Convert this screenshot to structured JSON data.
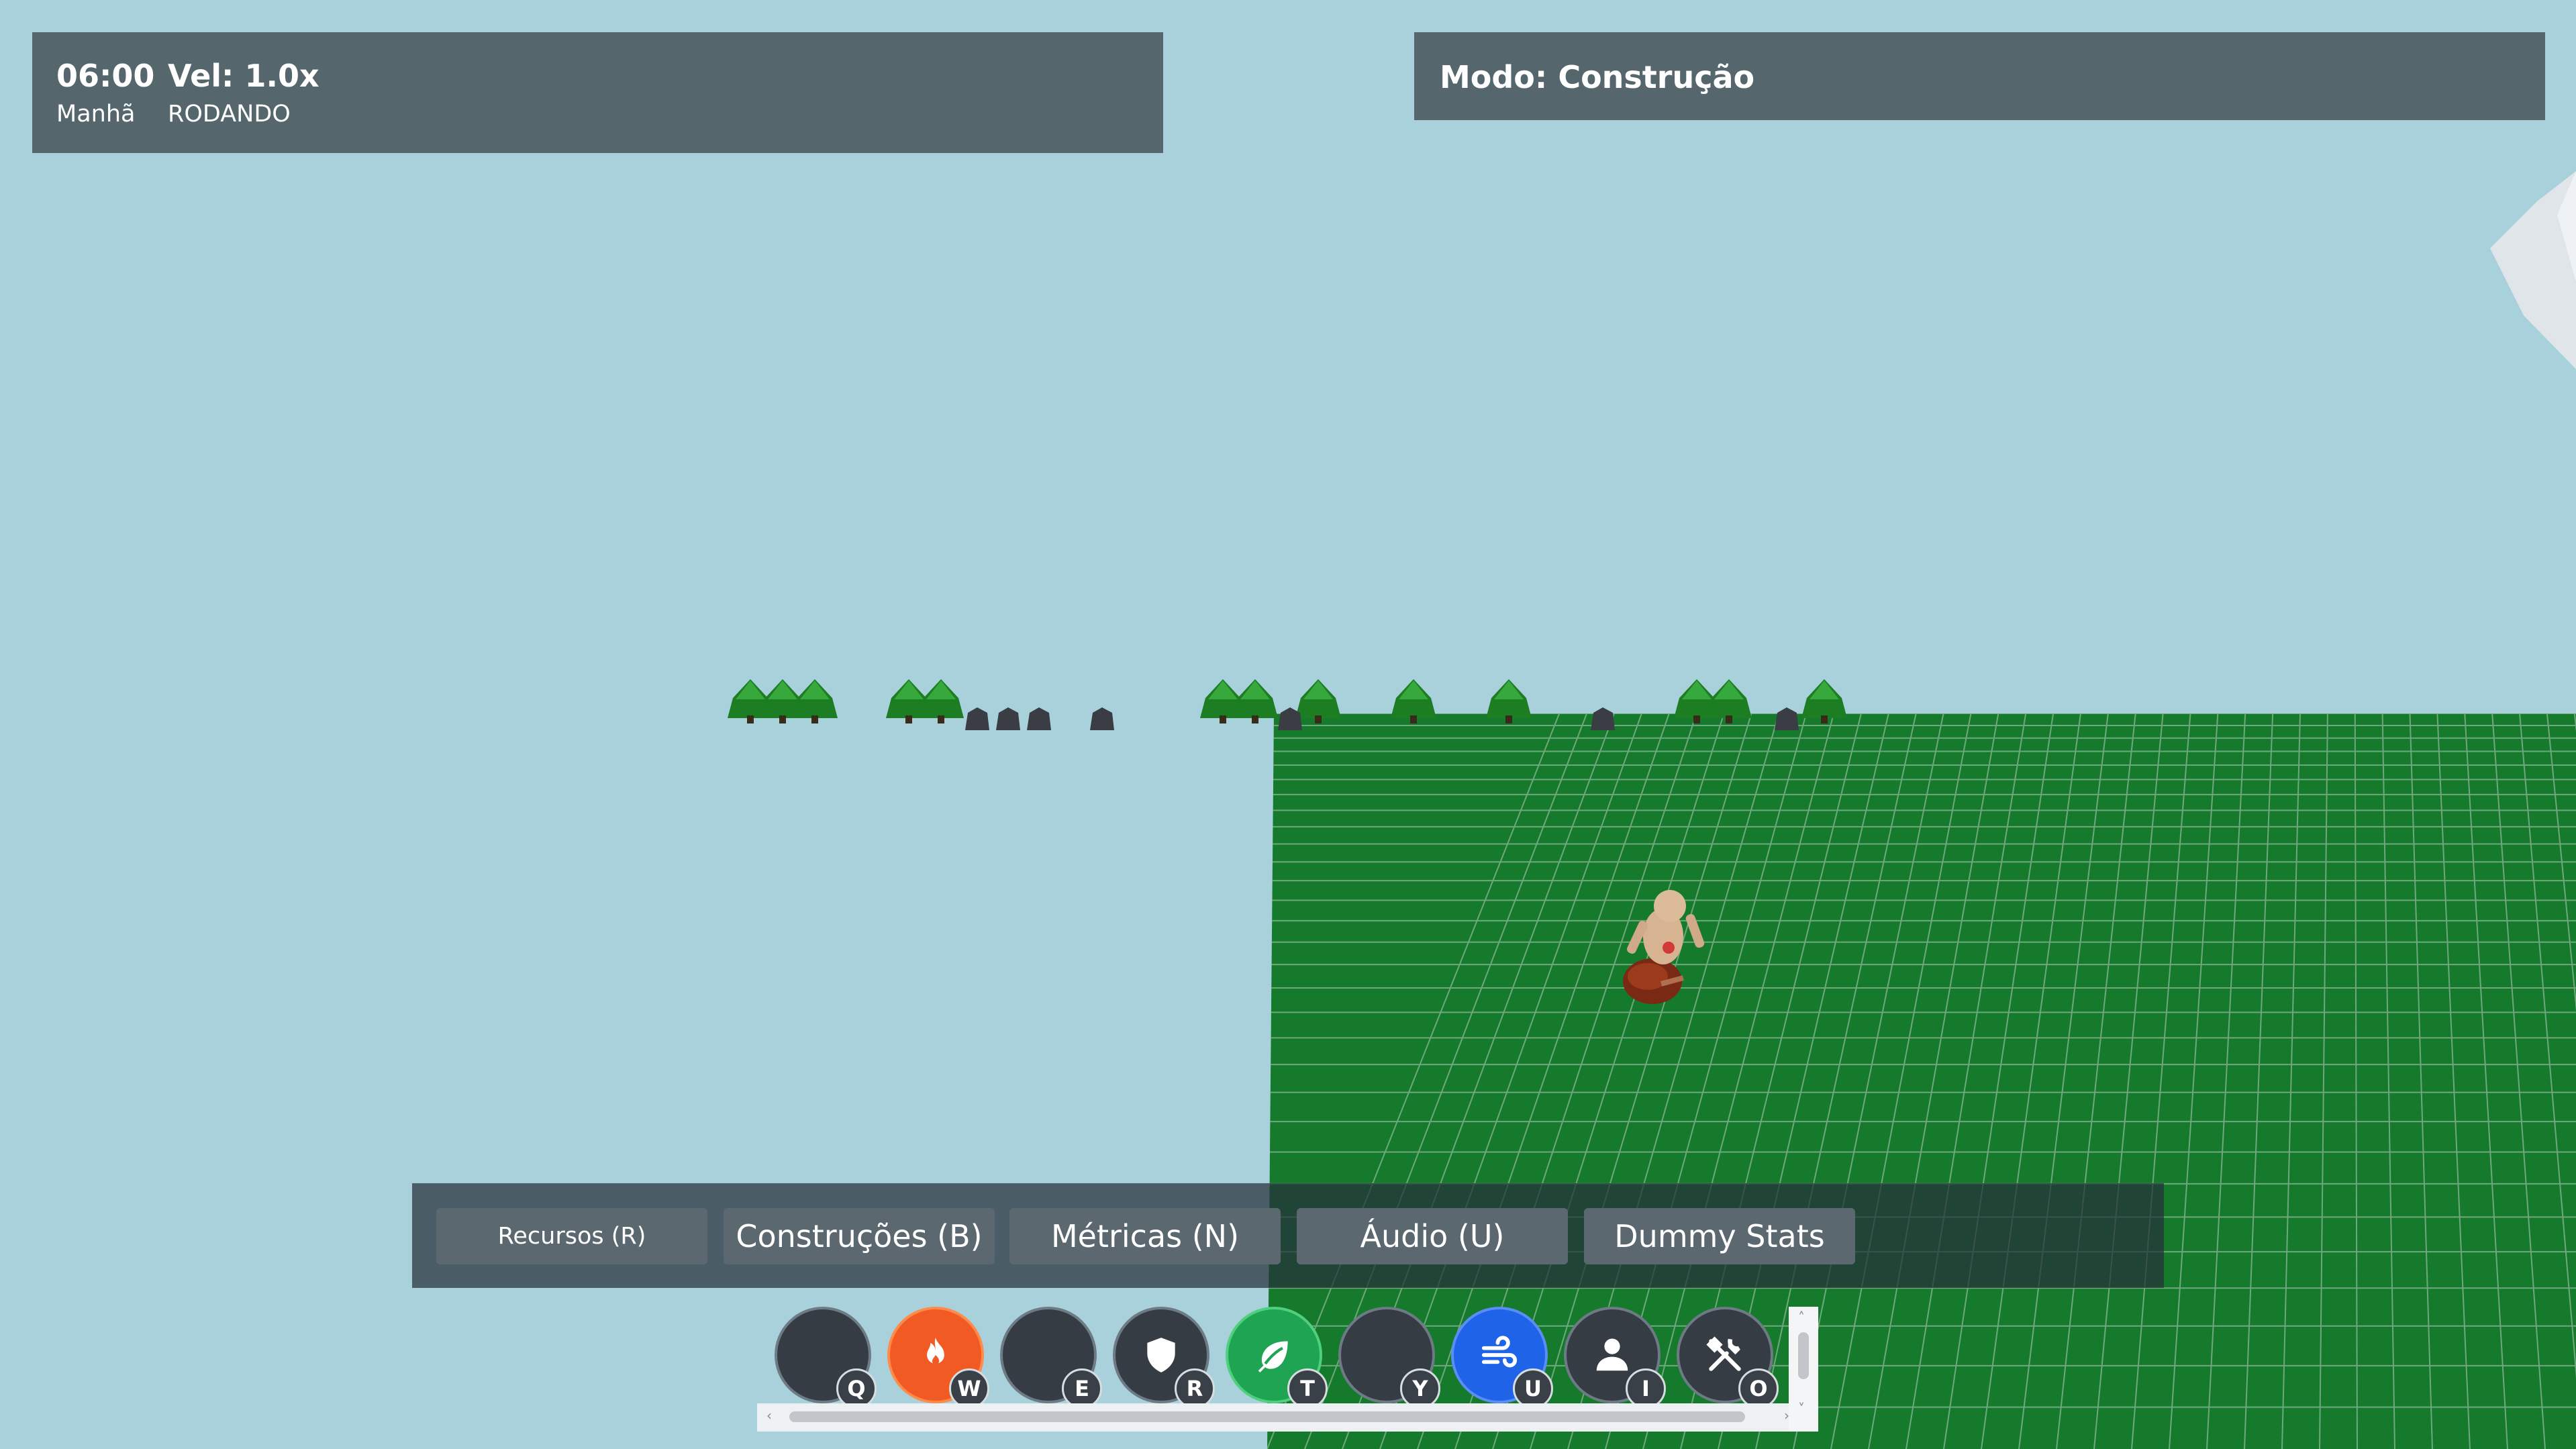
{
  "hud": {
    "time": "06:00",
    "period": "Manhã",
    "speed": "Vel: 1.0x",
    "status": "RODANDO",
    "mode": "Modo: Construção"
  },
  "tabs": [
    {
      "label": "Recursos (R)"
    },
    {
      "label": "Construções (B)"
    },
    {
      "label": "Métricas (N)"
    },
    {
      "label": "Áudio (U)"
    },
    {
      "label": "Dummy Stats"
    }
  ],
  "toolbar": [
    {
      "key": "Q",
      "icon": "empty-slot-icon",
      "color": "#363c44"
    },
    {
      "key": "W",
      "icon": "fire-icon",
      "color": "#f15a22"
    },
    {
      "key": "E",
      "icon": "empty-slot-icon",
      "color": "#363c44"
    },
    {
      "key": "R",
      "icon": "shield-icon",
      "color": "#363c44"
    },
    {
      "key": "T",
      "icon": "leaf-icon",
      "color": "#1fa454"
    },
    {
      "key": "Y",
      "icon": "empty-slot-icon",
      "color": "#363c44"
    },
    {
      "key": "U",
      "icon": "wind-icon",
      "color": "#1f63e8"
    },
    {
      "key": "I",
      "icon": "person-icon",
      "color": "#363c44"
    },
    {
      "key": "O",
      "icon": "tools-icon",
      "color": "#363c44"
    }
  ],
  "colors": {
    "sky": "#a8d1dc",
    "ground": "#157a2c",
    "grid": "#6fa87c",
    "panel": "#55666c"
  }
}
